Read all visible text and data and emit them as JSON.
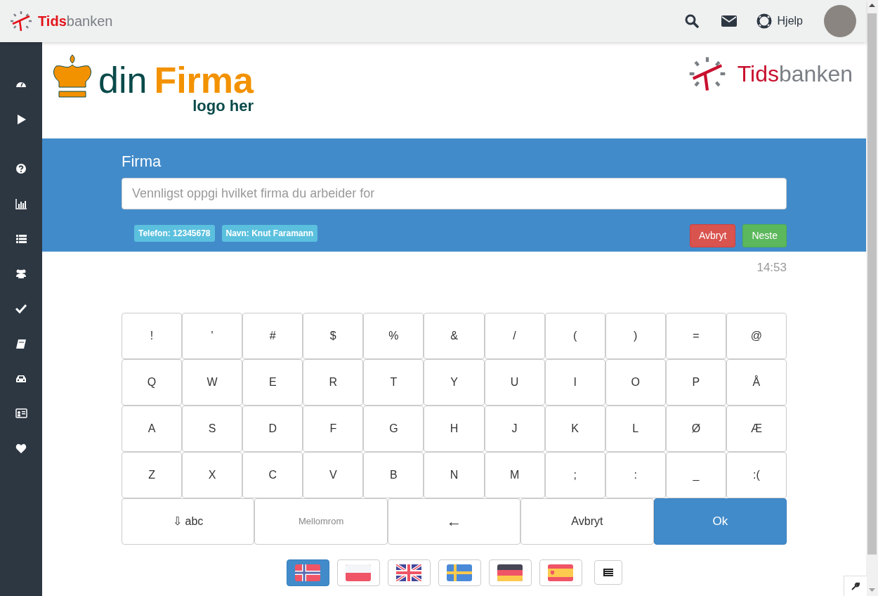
{
  "topbar": {
    "brand": {
      "part_1": "Tids",
      "part_2": "banken"
    },
    "help": "Hjelp"
  },
  "header": {
    "company_logo": {
      "word_1": "din",
      "word_2": "Firma",
      "tagline": "logo her"
    },
    "vendor_logo": {
      "part_1": "Tids",
      "part_2": "banken"
    }
  },
  "form": {
    "label": "Firma",
    "placeholder": "Vennligst oppgi hvilket firma du arbeider for",
    "badges": [
      "Telefon: 12345678",
      "Navn: Knut Faramann"
    ],
    "buttons": [
      {
        "kind": "danger",
        "label": "Avbryt"
      },
      {
        "kind": "success",
        "label": "Neste"
      }
    ]
  },
  "time": "14:53",
  "keyboard": {
    "rows": [
      [
        "!",
        "'",
        "#",
        "$",
        "%",
        "&",
        "/",
        "(",
        ")",
        "=",
        "@"
      ],
      [
        "Q",
        "W",
        "E",
        "R",
        "T",
        "Y",
        "U",
        "I",
        "O",
        "P",
        "Å"
      ],
      [
        "A",
        "S",
        "D",
        "F",
        "G",
        "H",
        "J",
        "K",
        "L",
        "Ø",
        "Æ"
      ],
      [
        "Z",
        "X",
        "C",
        "V",
        "B",
        "N",
        "M",
        ";",
        ":",
        "_",
        ":("
      ]
    ],
    "actions": [
      {
        "kind": "shift",
        "label": "⇩ abc"
      },
      {
        "kind": "space",
        "label": "Mellomrom"
      },
      {
        "kind": "backspace",
        "label": "←"
      },
      {
        "kind": "cancel",
        "label": "Avbryt"
      },
      {
        "kind": "ok",
        "label": "Ok"
      }
    ]
  },
  "languages": [
    {
      "kind": "norway",
      "selected": true
    },
    {
      "kind": "poland",
      "selected": false
    },
    {
      "kind": "uk",
      "selected": false
    },
    {
      "kind": "sweden",
      "selected": false
    },
    {
      "kind": "germany",
      "selected": false
    },
    {
      "kind": "spain",
      "selected": false
    },
    {
      "kind": "list",
      "selected": false
    }
  ]
}
